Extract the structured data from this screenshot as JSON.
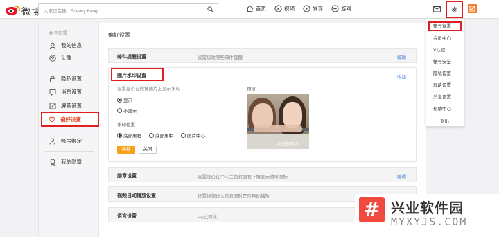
{
  "header": {
    "logo_text": "微博",
    "search_placeholder": "大家正在搜：Sneaky Bang",
    "nav": [
      {
        "label": "首页"
      },
      {
        "label": "视频"
      },
      {
        "label": "发现"
      },
      {
        "label": "游戏"
      }
    ]
  },
  "sidebar": {
    "header": "帐号设置",
    "items": [
      {
        "label": "我的信息"
      },
      {
        "label": "头像"
      },
      {
        "label": "隐私设置"
      },
      {
        "label": "消息设置"
      },
      {
        "label": "屏蔽设置"
      },
      {
        "label": "偏好设置",
        "active": true
      },
      {
        "label": "帐号绑定"
      },
      {
        "label": "我的勋章"
      }
    ]
  },
  "main": {
    "title": "偏好设置",
    "rows": {
      "mail": {
        "label": "邮件提醒设置",
        "desc": "设置接收哪些邮件提醒",
        "action": "编辑"
      },
      "medal": {
        "label": "勋章设置",
        "desc": "设置是否在个人主页封面右下角显示勋章图标",
        "action": "编辑"
      },
      "video": {
        "label": "视频自动播放设置",
        "desc": "设置视频进入信息流时是否自动播放"
      },
      "lang": {
        "label": "语言设置",
        "desc": "中文(简体)"
      }
    },
    "watermark": {
      "label": "图片水印设置",
      "collapse": "收起",
      "question": "设置是否在微博图片上显示水印",
      "show_options": [
        {
          "label": "显示",
          "selected": true
        },
        {
          "label": "不显示",
          "selected": false
        }
      ],
      "position_label": "水印位置",
      "position_options": [
        {
          "label": "底部居右",
          "selected": true
        },
        {
          "label": "底部居中",
          "selected": false
        },
        {
          "label": "图片中心",
          "selected": false
        }
      ],
      "save": "保存",
      "close": "关闭",
      "preview_label": "预览",
      "preview_watermark": "@你的昵称"
    }
  },
  "dropdown": {
    "items": [
      {
        "label": "帐号设置",
        "highlight": true
      },
      {
        "label": "会员中心"
      },
      {
        "label": "V认证"
      },
      {
        "label": "帐号安全"
      },
      {
        "label": "隐私设置"
      },
      {
        "label": "屏蔽设置"
      },
      {
        "label": "消息设置"
      },
      {
        "label": "帮助中心"
      },
      {
        "label": "退出"
      }
    ]
  },
  "banner": {
    "logo_char": "#",
    "cn": "兴业软件园",
    "en": "MYXYJS.COM"
  },
  "colors": {
    "highlight_border": "#e02020",
    "link": "#3a7bd5",
    "save_button": "#f7a21b",
    "brand_red": "#e6162d"
  }
}
